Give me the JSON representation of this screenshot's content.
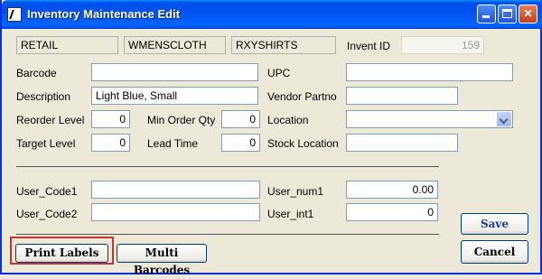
{
  "window": {
    "title": "Inventory Maintenance Edit"
  },
  "header_row": {
    "department": "RETAIL",
    "category": "WMENSCLOTH",
    "subcategory": "RXYSHIRTS",
    "invent_id_label": "Invent ID",
    "invent_id_value": "159"
  },
  "fields": {
    "barcode_label": "Barcode",
    "barcode_value": "",
    "upc_label": "UPC",
    "upc_value": "",
    "description_label": "Description",
    "description_value": "Light Blue, Small",
    "vendor_partno_label": "Vendor Partno",
    "vendor_partno_value": "",
    "reorder_level_label": "Reorder Level",
    "reorder_level_value": "0",
    "min_order_qty_label": "Min Order Qty",
    "min_order_qty_value": "0",
    "location_label": "Location",
    "location_value": "",
    "target_level_label": "Target Level",
    "target_level_value": "0",
    "lead_time_label": "Lead Time",
    "lead_time_value": "0",
    "stock_location_label": "Stock Location",
    "stock_location_value": ""
  },
  "user_fields": {
    "user_code1_label": "User_Code1",
    "user_code1_value": "",
    "user_code2_label": "User_Code2",
    "user_code2_value": "",
    "user_num1_label": "User_num1",
    "user_num1_value": "0.00",
    "user_int1_label": "User_int1",
    "user_int1_value": "0"
  },
  "buttons": {
    "print_labels": "Print Labels",
    "multi_barcodes": "Multi Barcodes",
    "save": "Save",
    "cancel": "Cancel"
  },
  "icons": {
    "app": "pencil-doc-icon",
    "minimize": "minimize-icon",
    "maximize": "maximize-icon",
    "close": "close-icon"
  },
  "colors": {
    "titlebar": "#0053ee",
    "window_bg": "#ece9d8",
    "focus_border": "#c83232"
  }
}
